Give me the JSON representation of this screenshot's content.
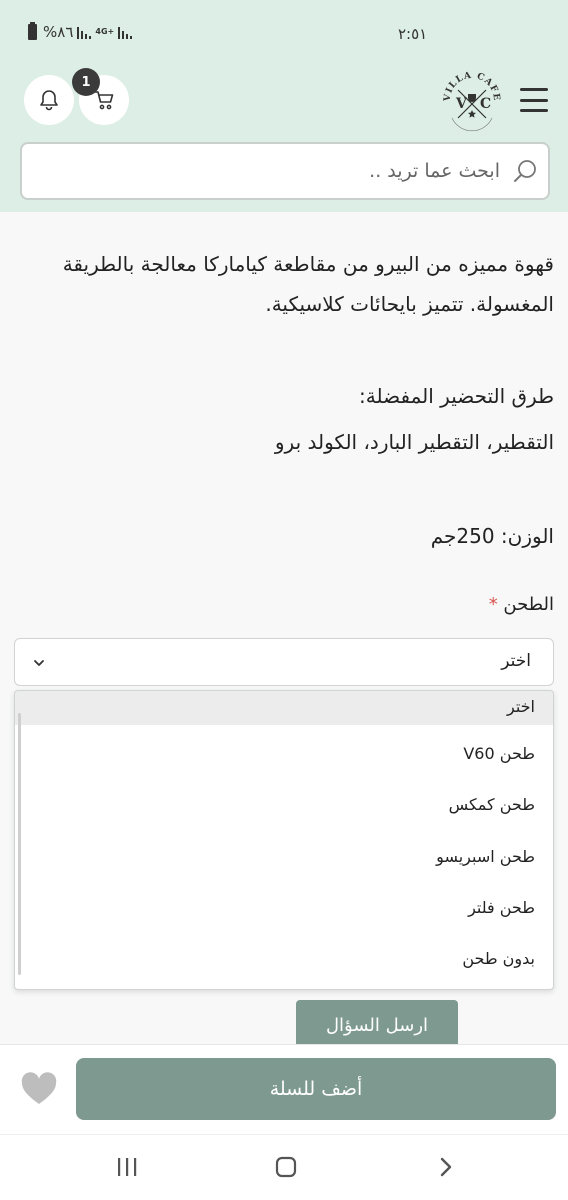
{
  "status_bar": {
    "time": "٢:٥١",
    "battery": "%٨٦",
    "network": "4G+"
  },
  "header": {
    "cart_count": "1",
    "logo_title": "VILLA CAFE",
    "logo_letter_left": "V",
    "logo_letter_right": "C"
  },
  "search": {
    "placeholder": "ابحث عما تريد .."
  },
  "product": {
    "description": "قهوة مميزه من البيرو من مقاطعة كياماركا معالجة بالطريقة المغسولة. تتميز بايحائات كلاسيكية.",
    "prep_title": "طرق التحضير المفضلة:",
    "prep_methods": "التقطير، التقطير البارد، الكولد برو",
    "weight": "الوزن: 250جم"
  },
  "grind": {
    "label": "الطحن",
    "required_mark": "*",
    "selected": "اختر",
    "options": [
      "اختر",
      "طحن V60",
      "طحن كمكس",
      "طحن اسبريسو",
      "طحن فلتر",
      "بدون طحن"
    ]
  },
  "buttons": {
    "ask_question": "ارسل السؤال",
    "add_to_cart": "أضف للسلة"
  },
  "colors": {
    "header_bg": "#dceee6",
    "accent": "#7e998f",
    "required": "#d9534f"
  },
  "icons": [
    "bell-icon",
    "cart-icon",
    "menu-icon",
    "search-icon",
    "chevron-down-icon",
    "heart-icon",
    "recents-icon",
    "home-icon",
    "back-icon"
  ]
}
